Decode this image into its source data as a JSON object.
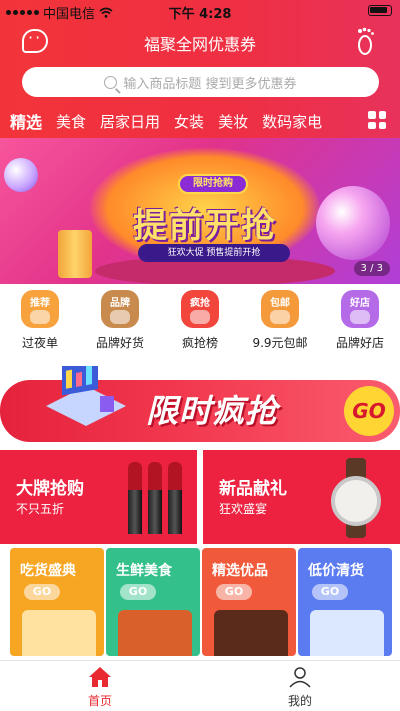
{
  "status_bar": {
    "carrier": "中国电信",
    "time": "下午 4:28"
  },
  "header": {
    "title": "福聚全网优惠券"
  },
  "search": {
    "placeholder": "输入商品标题  搜到更多优惠券"
  },
  "tabs": [
    {
      "label": "精选",
      "active": true
    },
    {
      "label": "美食",
      "active": false
    },
    {
      "label": "居家日用",
      "active": false
    },
    {
      "label": "女装",
      "active": false
    },
    {
      "label": "美妆",
      "active": false
    },
    {
      "label": "数码家电",
      "active": false
    }
  ],
  "banner": {
    "pill": "限时抢购",
    "headline": "提前开抢",
    "sub": "狂欢大促  预售提前开抢",
    "counter": "3 / 3"
  },
  "categories": [
    {
      "tag": "推荐",
      "label": "过夜单",
      "color": "#f7a23c"
    },
    {
      "tag": "品牌",
      "label": "品牌好货",
      "color": "#c98a4e"
    },
    {
      "tag": "疯抢",
      "label": "疯抢榜",
      "color": "#f2453c"
    },
    {
      "tag": "包邮",
      "label": "9.9元包邮",
      "color": "#f59a3a"
    },
    {
      "tag": "好店",
      "label": "品牌好店",
      "color": "#b56be8"
    }
  ],
  "flash_sale": {
    "label": "限时疯抢",
    "go": "GO"
  },
  "promos": [
    {
      "title": "大牌抢购",
      "subtitle": "不只五折"
    },
    {
      "title": "新品献礼",
      "subtitle": "狂欢盛宴"
    }
  ],
  "cards": [
    {
      "title": "吃货盛典",
      "go": "GO",
      "color": "#f6a623"
    },
    {
      "title": "生鲜美食",
      "go": "GO",
      "color": "#33c08a"
    },
    {
      "title": "精选优品",
      "go": "GO",
      "color": "#f05a3a"
    },
    {
      "title": "低价清货",
      "go": "GO",
      "color": "#5b7cf0"
    }
  ],
  "bottom_nav": [
    {
      "label": "首页",
      "active": true
    },
    {
      "label": "我的",
      "active": false
    }
  ],
  "colors": {
    "brand_red": "#ef2f43",
    "accent_yellow": "#ffd534"
  }
}
